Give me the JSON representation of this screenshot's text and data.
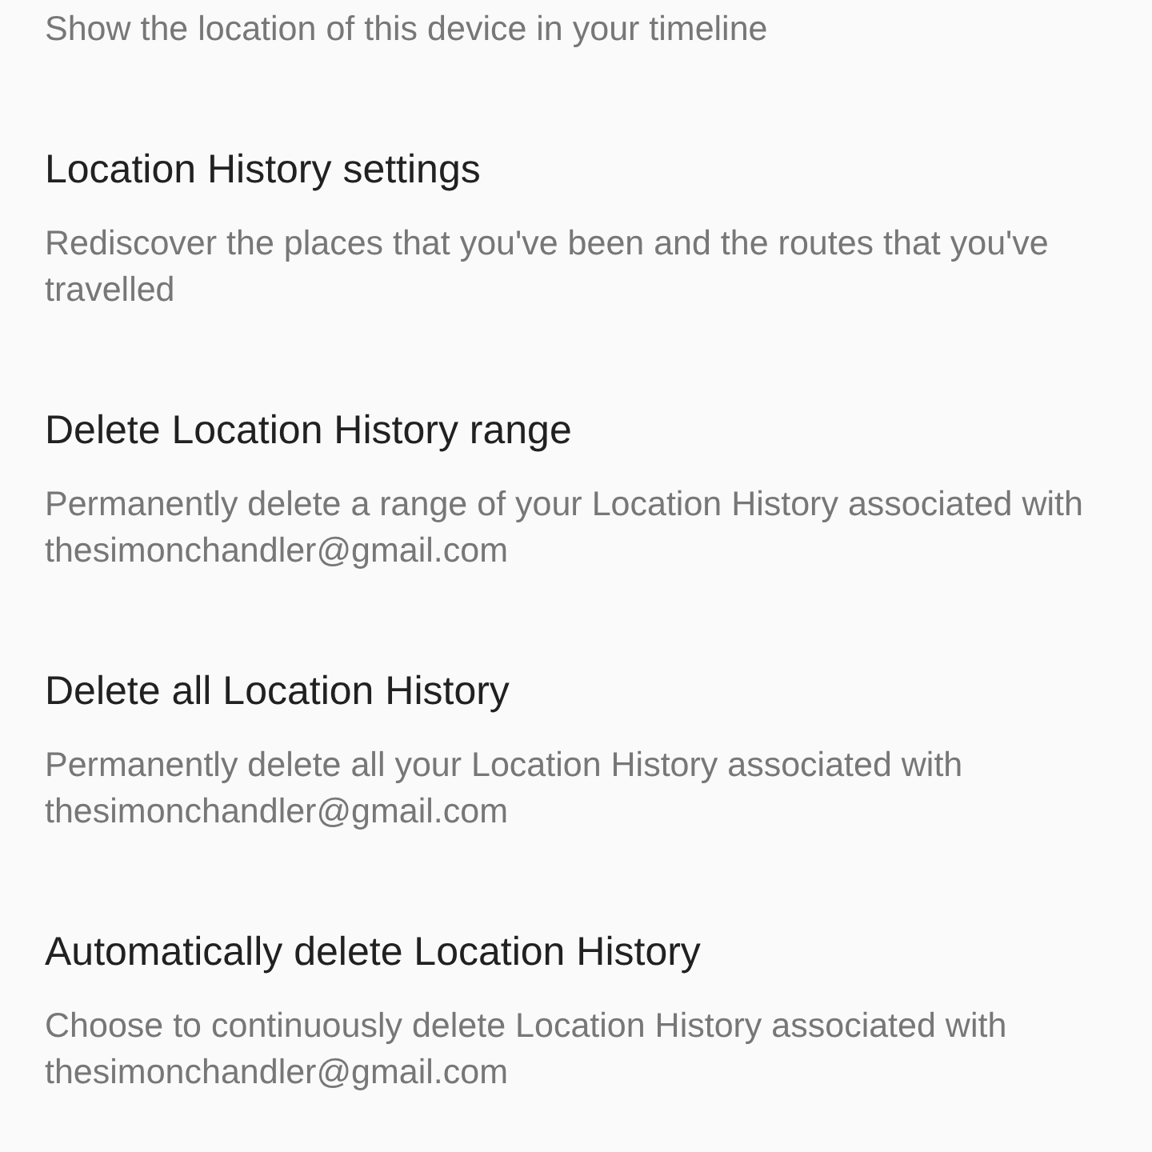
{
  "settings": [
    {
      "description": "Show the location of this device in your timeline"
    },
    {
      "title": "Location History settings",
      "description": "Rediscover the places that you've been and the routes that you've travelled"
    },
    {
      "title": "Delete Location History range",
      "description": "Permanently delete a range of your Location History associated with thesimonchandler@gmail.com"
    },
    {
      "title": "Delete all Location History",
      "description": "Permanently delete all your Location History associated with thesimonchandler@gmail.com"
    },
    {
      "title": "Automatically delete Location History",
      "description": "Choose to continuously delete Location History associated with thesimonchandler@gmail.com"
    }
  ]
}
